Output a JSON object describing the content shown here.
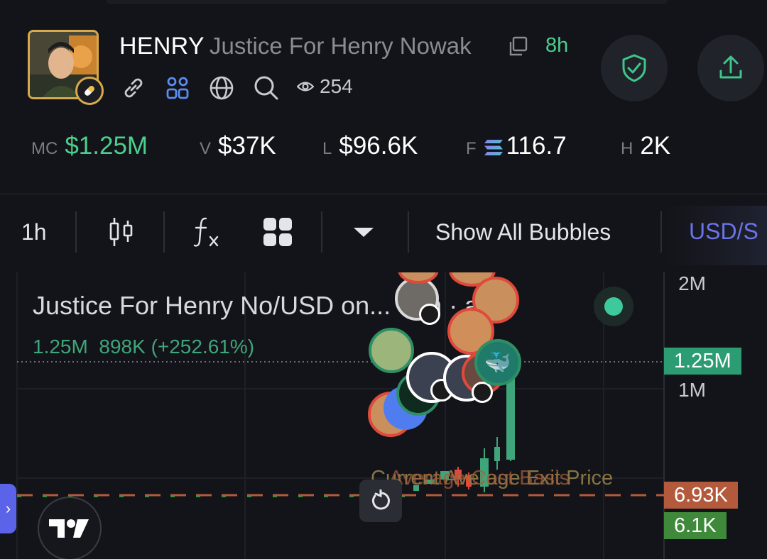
{
  "header": {
    "ticker": "HENRY",
    "token_name": "Justice For Henry Nowak",
    "age": "8h",
    "views": "254"
  },
  "stats": [
    {
      "key": "MC",
      "value": "$1.25M"
    },
    {
      "key": "V",
      "value": "$37K"
    },
    {
      "key": "L",
      "value": "$96.6K"
    },
    {
      "key": "F",
      "value": "116.7"
    },
    {
      "key": "H",
      "value": "2K"
    }
  ],
  "toolbar": {
    "interval": "1h",
    "bubbles_label": "Show All Bubbles",
    "currency_label": "USD/S"
  },
  "chart": {
    "pair_title": "Justice For Henry No/USD on... · 1h · a...",
    "last_value": "1.25M",
    "change": "898K (+252.61%)",
    "axis_labels": [
      "2M",
      "1M"
    ],
    "price_tags": {
      "current": "1.25M",
      "avg_exit": "6.93K",
      "cost": "6.1K"
    },
    "overlay_label_1": "Current Average Exit Price",
    "overlay_label_2": "Average Cost Basis"
  },
  "colors": {
    "accent_green": "#4ccf8d",
    "candle_up": "#3fa57a",
    "candle_down": "#e0493b",
    "price_tag_green": "#2c9c72",
    "price_tag_orange": "#b45a3c",
    "price_tag_cost": "#3f8a3a",
    "brand_blue": "#5b63e8"
  }
}
